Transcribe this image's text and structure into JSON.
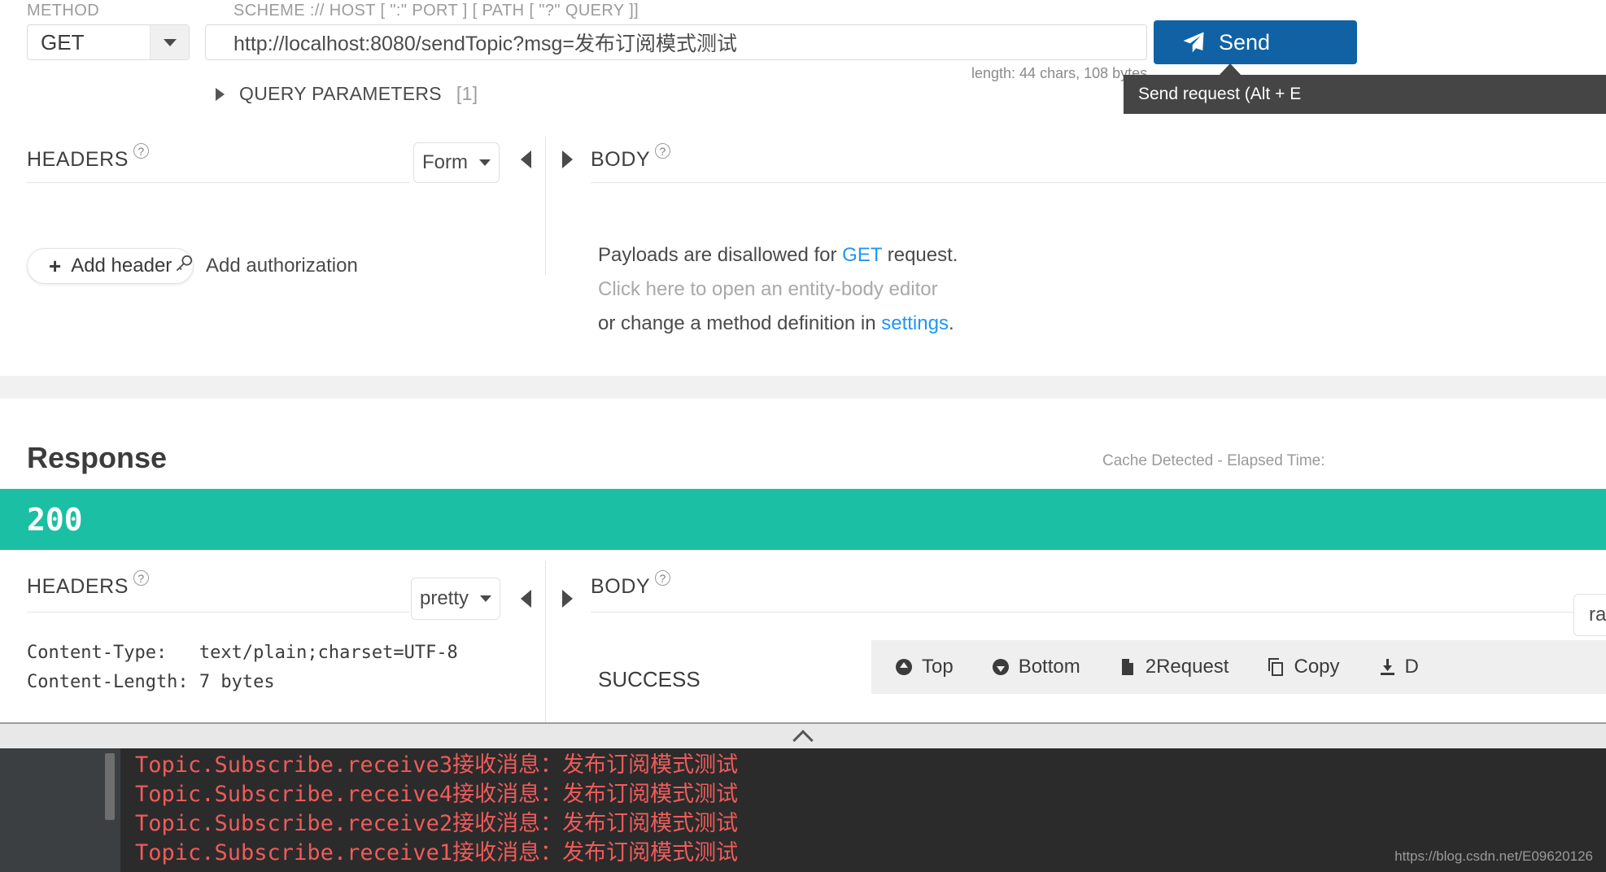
{
  "request": {
    "method_label": "METHOD",
    "scheme_label": "SCHEME :// HOST [ \":\" PORT ] [ PATH [ \"?\" QUERY ]]",
    "method_value": "GET",
    "url_value": "http://localhost:8080/sendTopic?msg=发布订阅模式测试",
    "send_label": "Send",
    "length_note": "length: 44 chars, 108 bytes",
    "tooltip": "Send request (Alt + E",
    "query_parameters_label": "QUERY PARAMETERS",
    "query_parameters_count": "[1]",
    "headers_label": "HEADERS",
    "headers_help": "?",
    "headers_format": "Form",
    "add_header_label": "Add header",
    "add_header_plus": "+",
    "add_authorization_label": "Add authorization",
    "body_label": "BODY",
    "body_help": "?",
    "body_line1_a": "Payloads are disallowed for ",
    "body_line1_method": "GET",
    "body_line1_b": " request.",
    "body_line2": "Click here to open an entity-body editor",
    "body_line3_a": "or change a method definition in ",
    "body_line3_link": "settings",
    "body_line3_b": "."
  },
  "response": {
    "title": "Response",
    "cache_note": "Cache Detected - Elapsed Time:",
    "status_code": "200",
    "status_color": "#1bbfa3",
    "headers_label": "HEADERS",
    "headers_help": "?",
    "headers_format": "pretty",
    "body_label": "BODY",
    "body_help": "?",
    "raw_select": "ra",
    "header_rows": [
      "Content-Type:   text/plain;charset=UTF-8",
      "Content-Length: 7 bytes"
    ],
    "body_text": "SUCCESS",
    "toolbar": [
      {
        "label": "Top",
        "icon": "arrow-up-circle-icon"
      },
      {
        "label": "Bottom",
        "icon": "arrow-down-circle-icon"
      },
      {
        "label": "2Request",
        "icon": "file-icon"
      },
      {
        "label": "Copy",
        "icon": "copy-icon"
      },
      {
        "label": "D",
        "icon": "download-icon"
      }
    ]
  },
  "console": {
    "lines": [
      "Topic.Subscribe.receive3接收消息：发布订阅模式测试",
      "Topic.Subscribe.receive4接收消息：发布订阅模式测试",
      "Topic.Subscribe.receive2接收消息：发布订阅模式测试",
      "Topic.Subscribe.receive1接收消息：发布订阅模式测试"
    ],
    "watermark": "https://blog.csdn.net/E09620126"
  }
}
